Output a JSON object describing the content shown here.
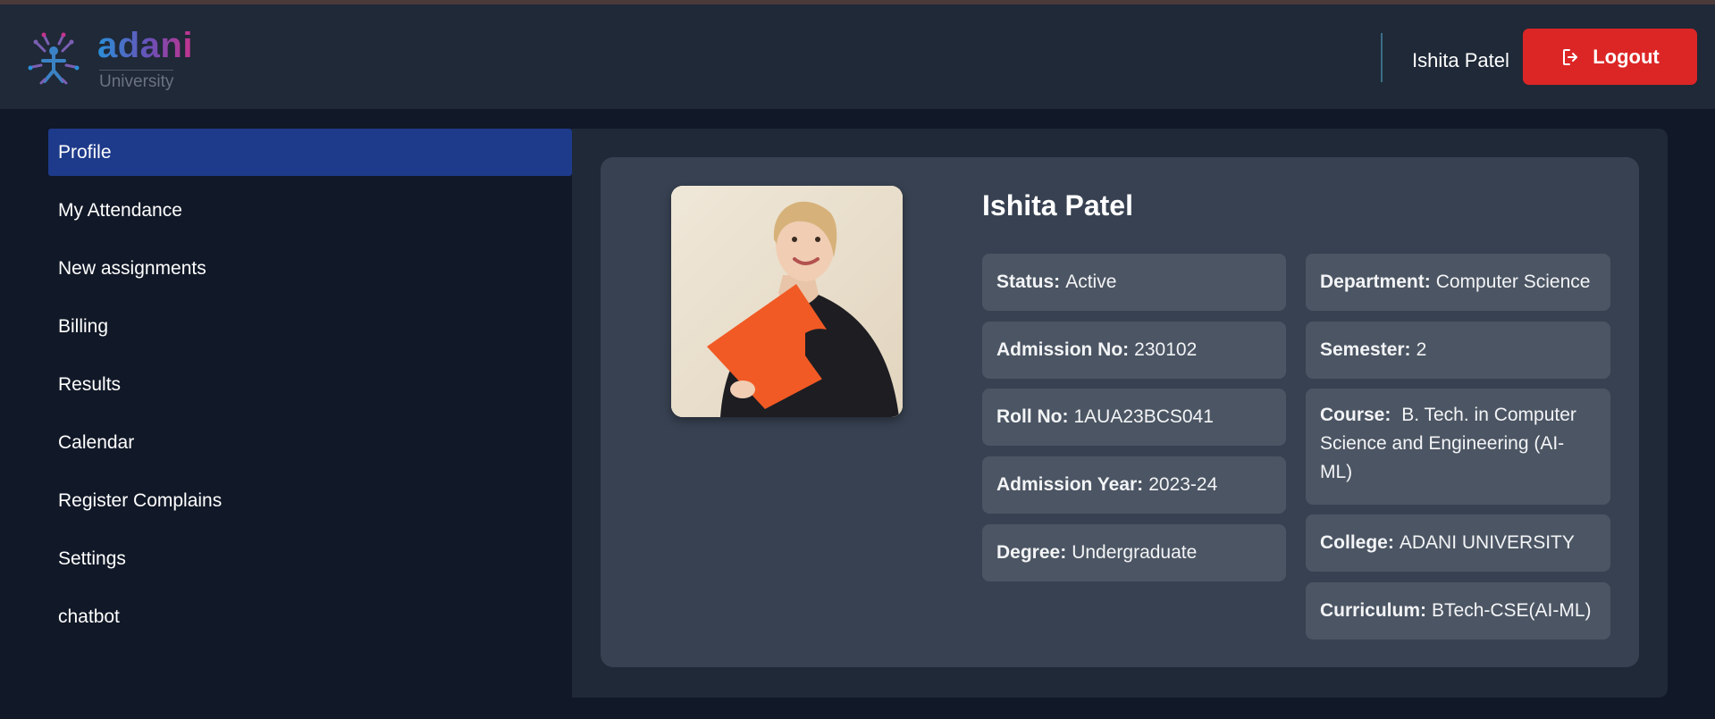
{
  "header": {
    "logo_word": "adani",
    "logo_sub": "University",
    "user_name": "Ishita Patel",
    "logout_label": "Logout",
    "logout_icon": "logout-icon",
    "colors": {
      "logout": "#dc2626",
      "accent_active": "#1e3a8a"
    }
  },
  "sidebar": {
    "items": [
      {
        "label": "Profile",
        "active": true
      },
      {
        "label": "My Attendance"
      },
      {
        "label": "New assignments"
      },
      {
        "label": "Billing"
      },
      {
        "label": "Results"
      },
      {
        "label": "Calendar"
      },
      {
        "label": "Register Complains"
      },
      {
        "label": "Settings"
      },
      {
        "label": "chatbot"
      }
    ]
  },
  "profile": {
    "name": "Ishita Patel",
    "left": [
      {
        "key": "Status:",
        "value": "Active"
      },
      {
        "key": "Admission No:",
        "value": "230102"
      },
      {
        "key": "Roll No:",
        "value": "1AUA23BCS041"
      },
      {
        "key": "Admission Year:",
        "value": "2023-24"
      },
      {
        "key": "Degree:",
        "value": "Undergraduate"
      }
    ],
    "right": [
      {
        "key": "Department:",
        "value": "Computer Science"
      },
      {
        "key": "Semester:",
        "value": "2"
      },
      {
        "key": "Course:",
        "value": "B. Tech. in Computer Science and Engineering (AI-ML)"
      },
      {
        "key": "College:",
        "value": "ADANI UNIVERSITY"
      },
      {
        "key": "Curriculum:",
        "value": "BTech-CSE(AI-ML)"
      }
    ]
  }
}
